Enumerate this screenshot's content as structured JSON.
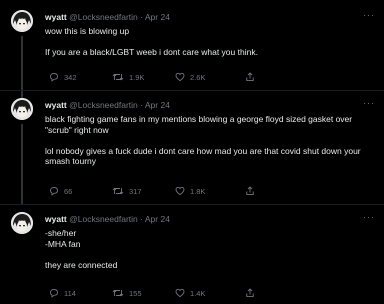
{
  "tweets": [
    {
      "name": "wyatt",
      "handle": "@Locksneedfartin",
      "sep": "·",
      "date": "Apr 24",
      "lines": [
        "wow this is blowing up",
        "",
        "If you are a black/LGBT weeb i dont care what you think."
      ],
      "replies": "342",
      "retweets": "1.9K",
      "likes": "2.6K"
    },
    {
      "name": "wyatt",
      "handle": "@Locksneedfartin",
      "sep": "·",
      "date": "Apr 24",
      "lines": [
        "black fighting game fans in my mentions blowing a george floyd sized gasket over \"scrub\" right now",
        "",
        "lol nobody gives a fuck dude i dont care how mad you are that covid shut down your smash tourny"
      ],
      "replies": "66",
      "retweets": "317",
      "likes": "1.8K"
    },
    {
      "name": "wyatt",
      "handle": "@Locksneedfartin",
      "sep": "·",
      "date": "Apr 24",
      "lines": [
        "-she/her",
        "-MHA fan",
        "",
        "they are connected"
      ],
      "replies": "114",
      "retweets": "155",
      "likes": "1.4K"
    }
  ],
  "icons": {
    "reply": "reply-icon",
    "retweet": "retweet-icon",
    "like": "heart-icon",
    "share": "share-icon",
    "more": "more-icon"
  },
  "colors": {
    "background": "#000000",
    "text": "#e7e9ea",
    "muted": "#71767b",
    "thread_line": "#2f3336"
  }
}
